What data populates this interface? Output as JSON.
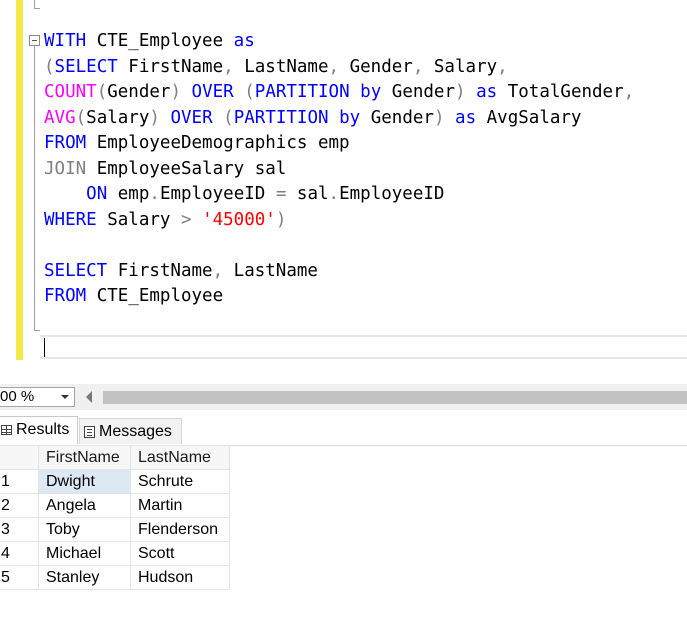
{
  "editor": {
    "code_lines": [
      [
        {
          "t": "WITH",
          "c": "kw"
        },
        {
          "t": " CTE_Employee "
        },
        {
          "t": "as",
          "c": "kw"
        }
      ],
      [
        {
          "t": "(",
          "c": "gr"
        },
        {
          "t": "SELECT",
          "c": "kw"
        },
        {
          "t": " FirstName"
        },
        {
          "t": ",",
          "c": "gr"
        },
        {
          "t": " LastName"
        },
        {
          "t": ",",
          "c": "gr"
        },
        {
          "t": " Gender"
        },
        {
          "t": ",",
          "c": "gr"
        },
        {
          "t": " Salary"
        },
        {
          "t": ",",
          "c": "gr"
        }
      ],
      [
        {
          "t": "COUNT",
          "c": "fn"
        },
        {
          "t": "(",
          "c": "gr"
        },
        {
          "t": "Gender"
        },
        {
          "t": ")",
          "c": "gr"
        },
        {
          "t": " "
        },
        {
          "t": "OVER",
          "c": "kw"
        },
        {
          "t": " "
        },
        {
          "t": "(",
          "c": "gr"
        },
        {
          "t": "PARTITION",
          "c": "kw"
        },
        {
          "t": " "
        },
        {
          "t": "by",
          "c": "kw"
        },
        {
          "t": " Gender"
        },
        {
          "t": ")",
          "c": "gr"
        },
        {
          "t": " "
        },
        {
          "t": "as",
          "c": "kw"
        },
        {
          "t": " TotalGender"
        },
        {
          "t": ",",
          "c": "gr"
        }
      ],
      [
        {
          "t": "AVG",
          "c": "fn"
        },
        {
          "t": "(",
          "c": "gr"
        },
        {
          "t": "Salary"
        },
        {
          "t": ")",
          "c": "gr"
        },
        {
          "t": " "
        },
        {
          "t": "OVER",
          "c": "kw"
        },
        {
          "t": " "
        },
        {
          "t": "(",
          "c": "gr"
        },
        {
          "t": "PARTITION",
          "c": "kw"
        },
        {
          "t": " "
        },
        {
          "t": "by",
          "c": "kw"
        },
        {
          "t": " Gender"
        },
        {
          "t": ")",
          "c": "gr"
        },
        {
          "t": " "
        },
        {
          "t": "as",
          "c": "kw"
        },
        {
          "t": " AvgSalary"
        }
      ],
      [
        {
          "t": "FROM",
          "c": "kw"
        },
        {
          "t": " EmployeeDemographics emp"
        }
      ],
      [
        {
          "t": "JOIN",
          "c": "gr"
        },
        {
          "t": " EmployeeSalary sal"
        }
      ],
      [
        {
          "t": "    "
        },
        {
          "t": "ON",
          "c": "kw"
        },
        {
          "t": " emp"
        },
        {
          "t": ".",
          "c": "gr"
        },
        {
          "t": "EmployeeID "
        },
        {
          "t": "=",
          "c": "gr"
        },
        {
          "t": " sal"
        },
        {
          "t": ".",
          "c": "gr"
        },
        {
          "t": "EmployeeID"
        }
      ],
      [
        {
          "t": "WHERE",
          "c": "kw"
        },
        {
          "t": " Salary "
        },
        {
          "t": ">",
          "c": "gr"
        },
        {
          "t": " "
        },
        {
          "t": "'45000'",
          "c": "str"
        },
        {
          "t": ")",
          "c": "gr"
        }
      ],
      [],
      [
        {
          "t": "SELECT",
          "c": "kw"
        },
        {
          "t": " FirstName"
        },
        {
          "t": ",",
          "c": "gr"
        },
        {
          "t": " LastName"
        }
      ],
      [
        {
          "t": "FROM",
          "c": "kw"
        },
        {
          "t": " CTE_Employee"
        }
      ]
    ]
  },
  "statusbar": {
    "zoom_value": "00 %"
  },
  "tabs": {
    "results_label": "Results",
    "messages_label": "Messages"
  },
  "grid": {
    "columns": [
      "FirstName",
      "LastName"
    ],
    "rows": [
      {
        "num": "1",
        "first": "Dwight",
        "last": "Schrute"
      },
      {
        "num": "2",
        "first": "Angela",
        "last": "Martin"
      },
      {
        "num": "3",
        "first": "Toby",
        "last": "Flenderson"
      },
      {
        "num": "4",
        "first": "Michael",
        "last": "Scott"
      },
      {
        "num": "5",
        "first": "Stanley",
        "last": "Hudson"
      }
    ]
  },
  "colors": {
    "keyword": "#0000ff",
    "function": "#ff00ff",
    "operator": "#808080",
    "string": "#ff0000",
    "change_bar": "#f5e94a"
  }
}
